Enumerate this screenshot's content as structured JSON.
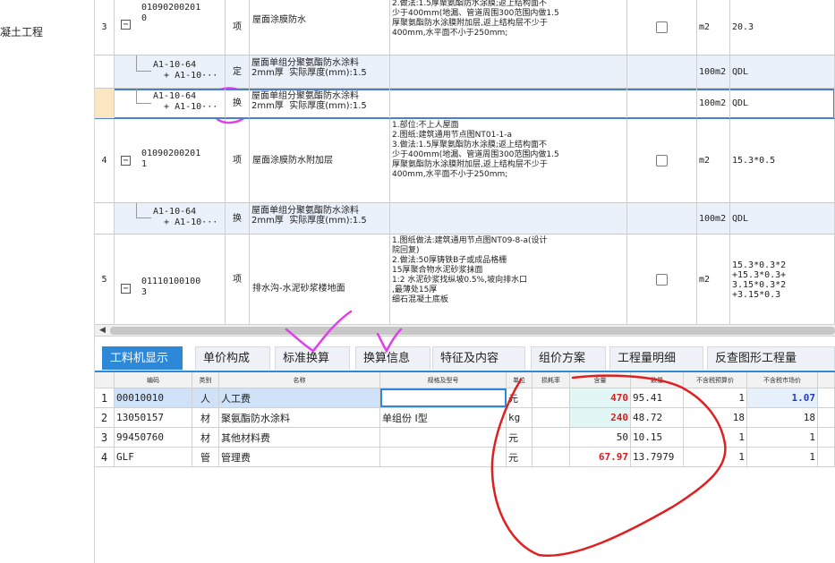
{
  "left_panel": {
    "tree_label": "凝土工程"
  },
  "top_rows": [
    {
      "no": "3",
      "kind": "main",
      "code": "01090200201\n0",
      "type": "项",
      "name": "屋面涂膜防水",
      "features": "2.做法:1.5厚聚氨酯防水涂膜;返上结构面不\n少于400mm(地漏、管道周围300范围内做1.5\n厚聚氨酯防水涂膜附加层,返上结构层不少于\n400mm,水平面不小于250mm;",
      "unit": "m2",
      "qty": "20.3"
    },
    {
      "no": "",
      "kind": "sub",
      "code": "A1-10-64\n  + A1-10···",
      "type": "定",
      "name": "屋面单组分聚氨酯防水涂料\n2mm厚  实际厚度(mm):1.5",
      "features": "",
      "unit": "100m2",
      "qty": "QDL"
    },
    {
      "no": "",
      "kind": "sub",
      "code": "A1-10-64\n  + A1-10···",
      "type": "换",
      "name": "屋面单组分聚氨酯防水涂料\n2mm厚  实际厚度(mm):1.5",
      "features": "",
      "unit": "100m2",
      "qty": "QDL"
    },
    {
      "no": "4",
      "kind": "main",
      "code": "01090200201\n1",
      "type": "项",
      "name": "屋面涂膜防水附加层",
      "features": "1.部位:不上人屋面\n2.图纸:建筑通用节点图NT01-1-a\n3.做法:1.5厚聚氨酯防水涂膜;返上结构面不\n少于400mm(地漏、管道周围300范围内做1.5\n厚聚氨酯防水涂膜附加层,返上结构层不少于\n400mm,水平面不小于250mm;",
      "unit": "m2",
      "qty": "15.3*0.5"
    },
    {
      "no": "",
      "kind": "sub",
      "code": "A1-10-64\n  + A1-10···",
      "type": "换",
      "name": "屋面单组分聚氨酯防水涂料\n2mm厚  实际厚度(mm):1.5",
      "features": "",
      "unit": "100m2",
      "qty": "QDL"
    },
    {
      "no": "5",
      "kind": "main",
      "code": "01110100100\n3",
      "type": "项",
      "name": "排水沟-水泥砂浆楼地面",
      "features": "1.图纸做法:建筑通用节点图NT09-8-a(设计\n院回复)\n2.做法:50厚铸铁B子或成品格栅\n15厚聚合物水泥砂浆抹面\n1:2 水泥砂浆找纵坡0.5%,坡向排水口\n,最薄处15厚\n细石混凝土底板",
      "unit": "m2",
      "qty": "15.3*0.3*2\n+15.3*0.3+\n3.15*0.3*2\n+3.15*0.3"
    }
  ],
  "tabs": [
    "工料机显示",
    "单价构成",
    "标准换算",
    "换算信息",
    "特征及内容",
    "组价方案",
    "工程量明细",
    "反查图形工程量"
  ],
  "resource_table": {
    "headers": [
      "编码",
      "类别",
      "名称",
      "规格及型号",
      "单位",
      "损耗率",
      "含量",
      "数量",
      "不含税预算价",
      "不含税市场价"
    ],
    "rows": [
      {
        "no": "1",
        "code": "00010010",
        "cat": "人",
        "name": "人工费",
        "spec": "",
        "unit": "元",
        "loss": "",
        "content": "470",
        "amount": "95.41",
        "price_budget": "1",
        "price_market": "1.07"
      },
      {
        "no": "2",
        "code": "13050157",
        "cat": "材",
        "name": "聚氨酯防水涂料",
        "spec": "单组份 I型",
        "unit": "kg",
        "loss": "",
        "content": "240",
        "amount": "48.72",
        "price_budget": "18",
        "price_market": "18"
      },
      {
        "no": "3",
        "code": "99450760",
        "cat": "材",
        "name": "其他材料费",
        "spec": "",
        "unit": "元",
        "loss": "",
        "content": "50",
        "amount": "10.15",
        "price_budget": "1",
        "price_market": "1"
      },
      {
        "no": "4",
        "code": "GLF",
        "cat": "管",
        "name": "管理费",
        "spec": "",
        "unit": "元",
        "loss": "",
        "content": "67.97",
        "amount": "13.7979",
        "price_budget": "1",
        "price_market": "1"
      }
    ]
  },
  "colors": {
    "accent": "#2e88d8",
    "annotation_magenta": "#e040e8",
    "annotation_red": "#e02020",
    "highlight_red": "#d31f1f"
  }
}
